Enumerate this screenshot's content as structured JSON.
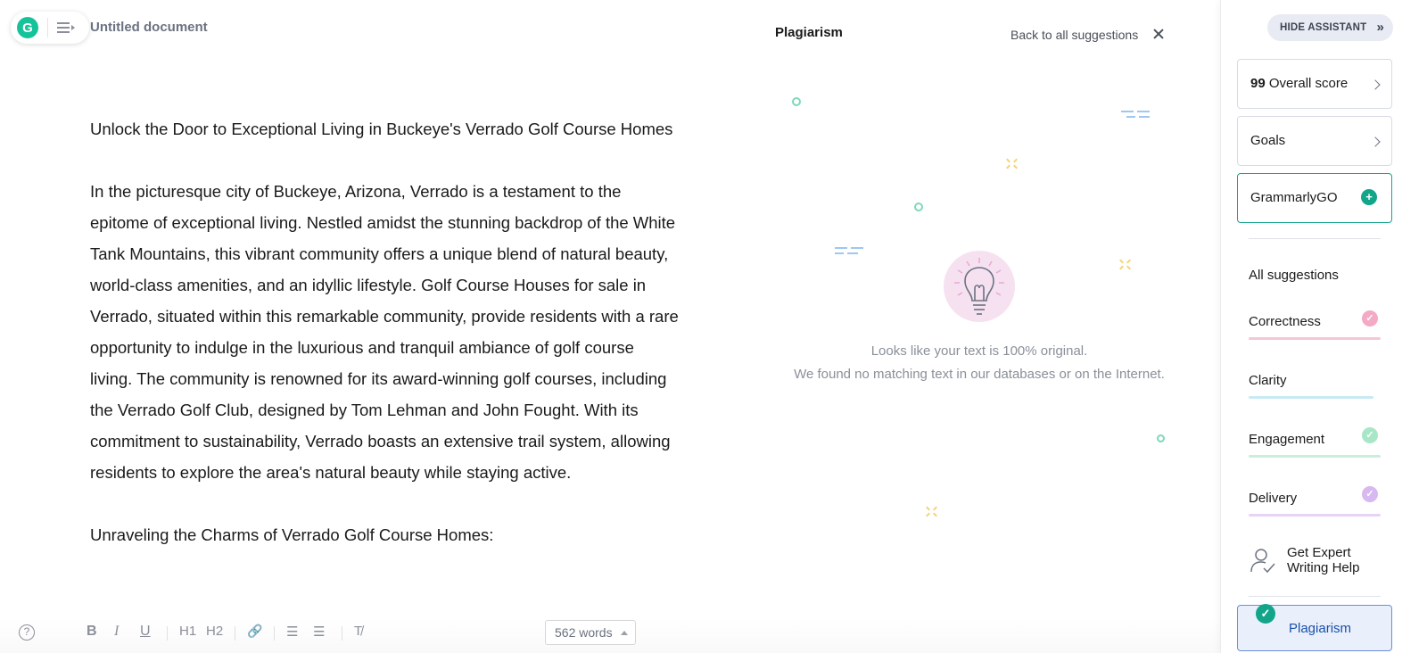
{
  "header": {
    "logo_letter": "G",
    "doc_title": "Untitled document"
  },
  "editor": {
    "paragraphs": [
      "Unlock the Door to Exceptional Living in Buckeye's Verrado Golf Course Homes",
      "In the picturesque city of Buckeye, Arizona, Verrado is a testament to the epitome of exceptional living. Nestled amidst the stunning backdrop of the White Tank Mountains, this vibrant community offers a unique blend of natural beauty, world-class amenities, and an idyllic lifestyle. Golf Course Houses for sale in Verrado, situated within this remarkable community, provide residents with a rare opportunity to indulge in the luxurious and tranquil ambiance of golf course living. The community is renowned for its award-winning golf courses, including the Verrado Golf Club, designed by Tom Lehman and John Fought. With its commitment to sustainability, Verrado boasts an extensive trail system, allowing residents to explore the area's natural beauty while staying active.",
      "Unraveling the Charms of Verrado Golf Course Homes:"
    ]
  },
  "toolbar": {
    "help": "?",
    "bold": "B",
    "italic": "I",
    "underline": "U",
    "h1": "H1",
    "h2": "H2",
    "link": "🔗",
    "ordered_list": "☰",
    "bullet_list": "☰",
    "clear_format": "T̸",
    "word_count": "562 words"
  },
  "plagiarism": {
    "title": "Plagiarism",
    "back_label": "Back to all suggestions",
    "message_line1": "Looks like your text is 100% original.",
    "message_line2": "We found no matching text in our databases or on the Internet."
  },
  "sidebar": {
    "hide_label": "HIDE ASSISTANT",
    "hide_chevron": "»",
    "score_value": "99",
    "score_label": "Overall score",
    "goals_label": "Goals",
    "go_label": "GrammarlyGO",
    "all_suggestions": "All suggestions",
    "categories": [
      {
        "label": "Correctness",
        "color": "#f4a9c4",
        "bar": "#f7c6d6",
        "checked": true
      },
      {
        "label": "Clarity",
        "color": "#9ed8ef",
        "bar": "#c9e9f5",
        "checked": false
      },
      {
        "label": "Engagement",
        "color": "#a8e6c8",
        "bar": "#c7efdc",
        "checked": true
      },
      {
        "label": "Delivery",
        "color": "#d8b8f1",
        "bar": "#e6d3f6",
        "checked": true
      }
    ],
    "expert_label": "Get Expert Writing Help",
    "plagiarism_label": "Plagiarism"
  }
}
